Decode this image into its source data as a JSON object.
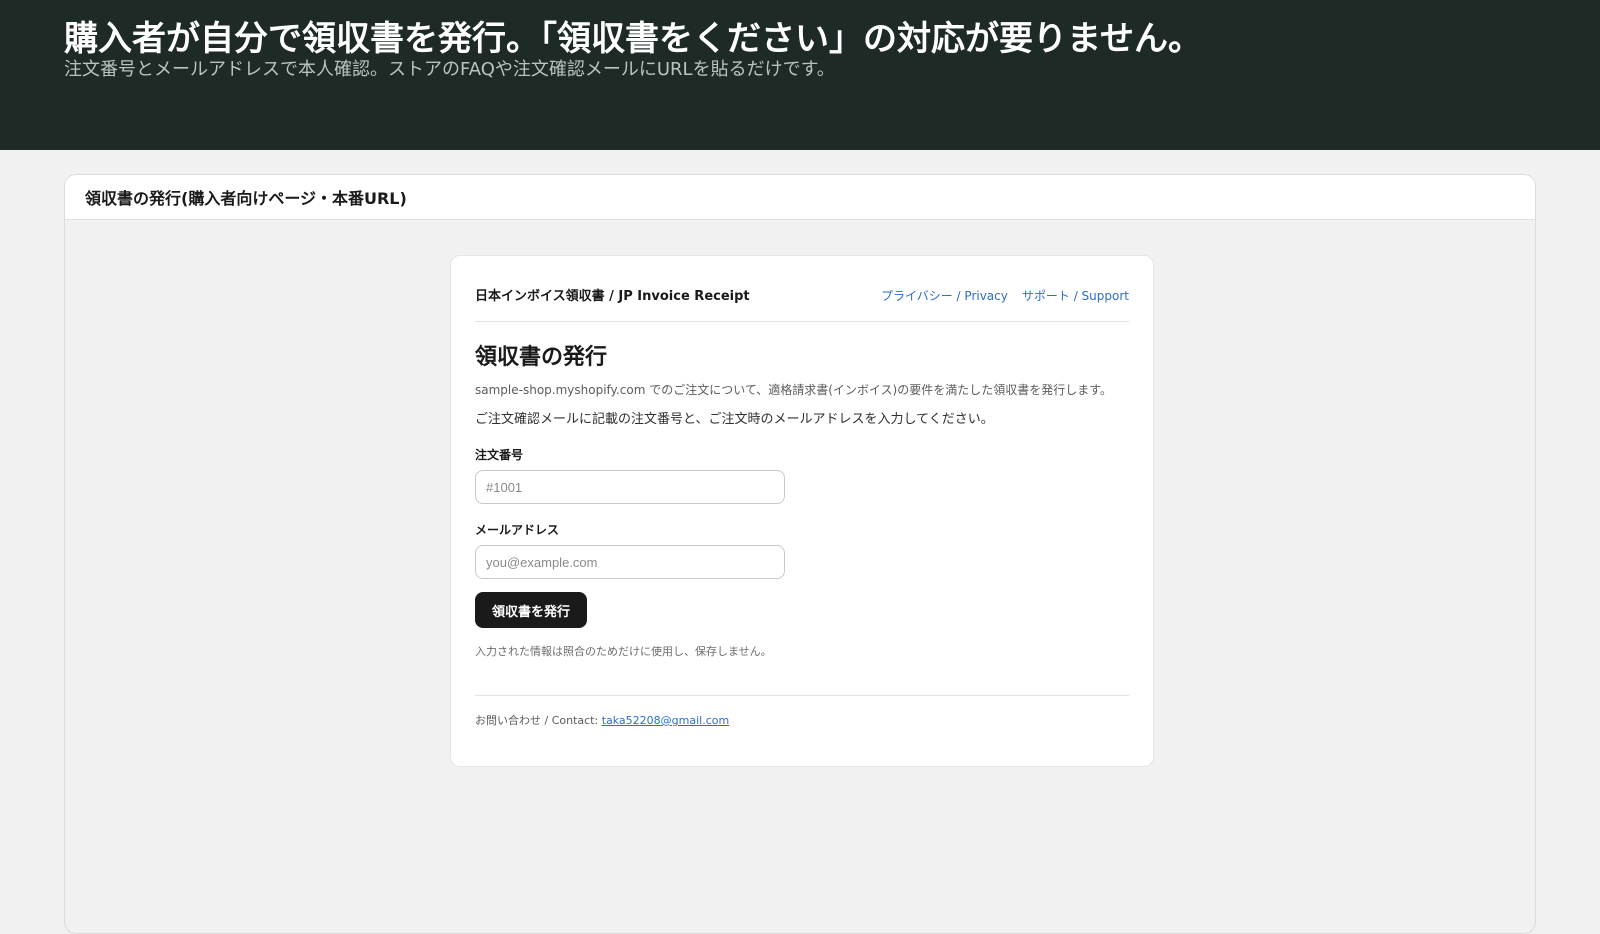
{
  "hero": {
    "title": "購入者が自分で領収書を発行。「領収書をください」の対応が要りません。",
    "subtitle": "注文番号とメールアドレスで本人確認。ストアのFAQや注文確認メールにURLを貼るだけです。"
  },
  "panel": {
    "title": "領収書の発行(購入者向けページ・本番URL)"
  },
  "receipt_page": {
    "app_name": "日本インボイス領収書 / JP Invoice Receipt",
    "privacy_link": "プライバシー / Privacy",
    "support_link": "サポート / Support",
    "heading": "領収書の発行",
    "description": "sample-shop.myshopify.com でのご注文について、適格請求書(インボイス)の要件を満たした領収書を発行します。",
    "instruction": "ご注文確認メールに記載の注文番号と、ご注文時のメールアドレスを入力してください。",
    "order_label": "注文番号",
    "order_placeholder": "#1001",
    "email_label": "メールアドレス",
    "email_placeholder": "you@example.com",
    "submit_label": "領収書を発行",
    "privacy_note": "入力された情報は照合のためだけに使用し、保存しません。",
    "contact_prefix": "お問い合わせ / Contact: ",
    "contact_email": "taka52208@gmail.com"
  },
  "colors": {
    "hero_bg": "#1e2a26",
    "button_bg": "#1a1a1a",
    "link": "#2c6ecb"
  }
}
